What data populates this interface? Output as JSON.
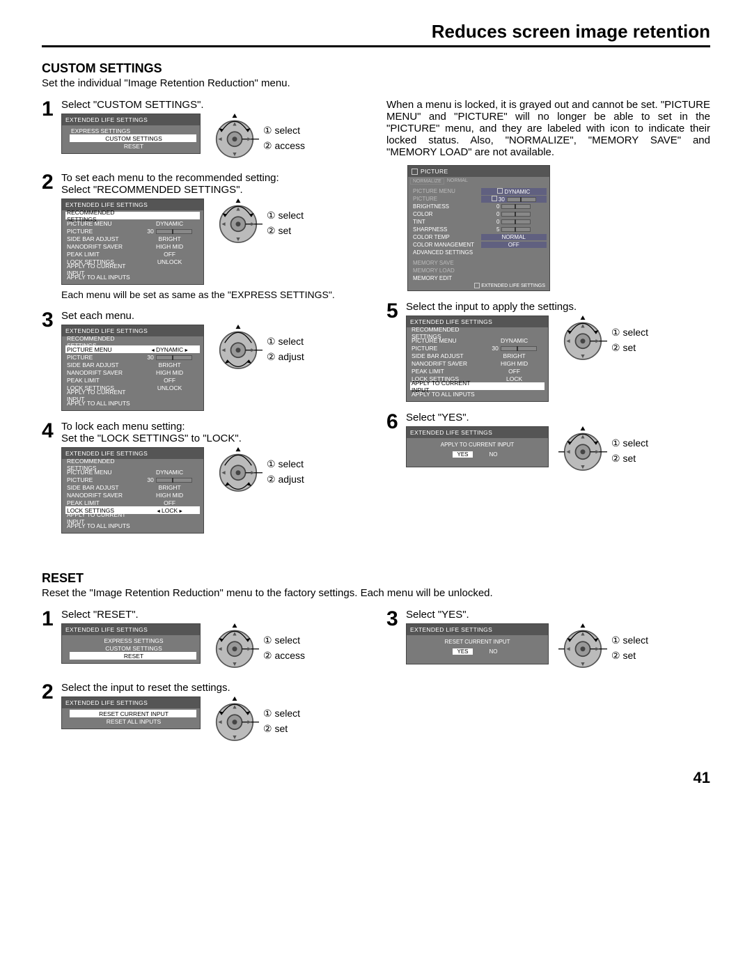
{
  "page_title": "Reduces screen image retention",
  "page_number": "41",
  "custom": {
    "heading": "CUSTOM SETTINGS",
    "intro": "Set the individual \"Image Retention Reduction\" menu.",
    "steps": {
      "s1": {
        "text": "Select \"CUSTOM SETTINGS\".",
        "dial1": "① select",
        "dial2": "② access"
      },
      "s2": {
        "top": "To set each menu to the recommended setting:",
        "text": "Select \"RECOMMENDED SETTINGS\".",
        "dial1": "① select",
        "dial2": "② set",
        "note": "Each menu will be set as same as the \"EXPRESS SETTINGS\"."
      },
      "s3": {
        "text": "Set each menu.",
        "dial1": "① select",
        "dial2": "② adjust"
      },
      "s4": {
        "top": "To lock each menu setting:",
        "text": "Set the \"LOCK  SETTINGS\" to \"LOCK\".",
        "dial1": "① select",
        "dial2": "② adjust"
      },
      "s5": {
        "text": "Select the input to apply the settings.",
        "dial1": "① select",
        "dial2": "② set"
      },
      "s6": {
        "text": "Select \"YES\".",
        "dial1": "① select",
        "dial2": "② set"
      }
    },
    "lock_paragraph": "When a menu is locked, it is grayed out and cannot be set. \"PICTURE MENU\" and \"PICTURE\" will no longer be able to set in the \"PICTURE\" menu, and they are labeled with icon to indicate their locked status. Also, \"NORMALIZE\", \"MEMORY SAVE\" and \"MEMORY LOAD\" are not available."
  },
  "reset": {
    "heading": "RESET",
    "intro": "Reset the \"Image Retention Reduction\" menu to the factory settings. Each menu will be unlocked.",
    "steps": {
      "r1": {
        "text": "Select \"RESET\".",
        "dial1": "① select",
        "dial2": "② access"
      },
      "r2": {
        "text": "Select the input to reset the settings.",
        "dial1": "① select",
        "dial2": "② set"
      },
      "r3": {
        "text": "Select \"YES\".",
        "dial1": "① select",
        "dial2": "② set"
      }
    }
  },
  "menus": {
    "els_title": "EXTENDED LIFE SETTINGS",
    "express": "EXPRESS SETTINGS",
    "custom": "CUSTOM SETTINGS",
    "reset": "RESET",
    "recommended": "RECOMMENDED SETTINGS",
    "picture_menu": "PICTURE MENU",
    "picture_menu_val": "DYNAMIC",
    "picture": "PICTURE",
    "picture_val": "30",
    "side_bar": "SIDE BAR ADJUST",
    "side_bar_val": "BRIGHT",
    "nanodrift": "NANODRIFT SAVER",
    "nanodrift_val": "HIGH MID",
    "peak": "PEAK LIMIT",
    "peak_val": "OFF",
    "lock_settings": "LOCK SETTINGS",
    "lock_unlock": "UNLOCK",
    "lock_lock": "LOCK",
    "apply_current": "APPLY TO CURRENT INPUT",
    "apply_all": "APPLY TO ALL INPUTS",
    "reset_current": "RESET CURRENT INPUT",
    "reset_all": "RESET ALL INPUTS",
    "yes": "YES",
    "no": "NO",
    "apply_title": "APPLY TO CURRENT INPUT",
    "els_footer": "EXTENDED LIFE SETTINGS"
  },
  "picture_osd": {
    "title": "PICTURE",
    "normalize": "NORMALIZE",
    "normal": "NORMAL",
    "rows": {
      "picture_menu": "PICTURE MENU",
      "picture_menu_val": "DYNAMIC",
      "picture": "PICTURE",
      "picture_val": "30",
      "brightness": "BRIGHTNESS",
      "brightness_val": "0",
      "color": "COLOR",
      "color_val": "0",
      "tint": "TINT",
      "tint_val": "0",
      "sharpness": "SHARPNESS",
      "sharpness_val": "5",
      "color_temp": "COLOR TEMP",
      "color_temp_val": "NORMAL",
      "color_mgmt": "COLOR MANAGEMENT",
      "color_mgmt_val": "OFF",
      "advanced": "ADVANCED SETTINGS",
      "mem_save": "MEMORY SAVE",
      "mem_load": "MEMORY LOAD",
      "mem_edit": "MEMORY EDIT"
    }
  }
}
